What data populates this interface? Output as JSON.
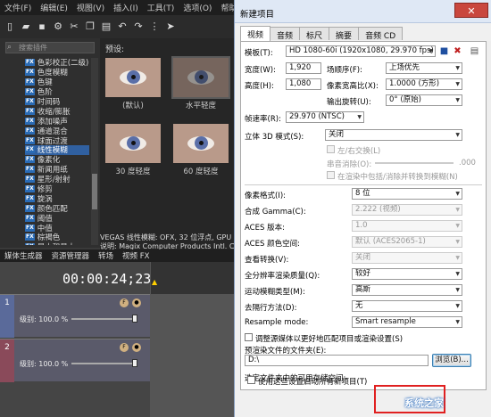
{
  "app": {
    "menu": [
      "文件(F)",
      "编辑(E)",
      "视图(V)",
      "插入(I)",
      "工具(T)",
      "选项(O)",
      "帮助"
    ],
    "fx_search_placeholder": "搜索插件",
    "fx_items": [
      {
        "label": "色彩校正(二级)",
        "selected": false
      },
      {
        "label": "色度模糊",
        "selected": false
      },
      {
        "label": "色键",
        "selected": false
      },
      {
        "label": "色阶",
        "selected": false
      },
      {
        "label": "时间码",
        "selected": false
      },
      {
        "label": "收缩/膨胀",
        "selected": false
      },
      {
        "label": "添加噪声",
        "selected": false
      },
      {
        "label": "通道混合",
        "selected": false
      },
      {
        "label": "球面过渡",
        "selected": false
      },
      {
        "label": "线性模糊",
        "selected": true
      },
      {
        "label": "像素化",
        "selected": false
      },
      {
        "label": "新闻用纸",
        "selected": false
      },
      {
        "label": "星形/射射",
        "selected": false
      },
      {
        "label": "修剪",
        "selected": false
      },
      {
        "label": "旋涡",
        "selected": false
      },
      {
        "label": "颜色匹配",
        "selected": false
      },
      {
        "label": "阈值",
        "selected": false
      },
      {
        "label": "中值",
        "selected": false
      },
      {
        "label": "棕褐色",
        "selected": false
      },
      {
        "label": "最小和最大",
        "selected": false
      }
    ],
    "fx_badge": "FX",
    "preview_label": "预设:",
    "thumbs": [
      {
        "caption": "(默认)"
      },
      {
        "caption": "水平轻度"
      },
      {
        "caption": "30 度轻度"
      },
      {
        "caption": "60 度轻度"
      }
    ],
    "status_line1": "VEGAS 线性模糊: OFX, 32 位浮点, GPU",
    "status_line2": "说明: Magix Computer Products Intl. Co.",
    "bottom_tabs": [
      "媒体生成器",
      "资源管理器",
      "转场",
      "视频 FX"
    ],
    "timecode": "00:00:24;23",
    "tracks": [
      {
        "num": "1",
        "level": "级别: 100.0 %",
        "color": "#5a6a9a"
      },
      {
        "num": "2",
        "level": "级别: 100.0 %",
        "color": "#8a4a5a"
      }
    ]
  },
  "dialog": {
    "title": "新建项目",
    "close_label": "✕",
    "tabs": [
      "视频",
      "音频",
      "标尺",
      "摘要",
      "音频 CD"
    ],
    "template_label": "模板(T):",
    "template_value": "HD 1080-60i (1920x1080, 29.970 fps)",
    "width_label": "宽度(W):",
    "width_value": "1,920",
    "field_order_label": "场顺序(F):",
    "field_order_value": "上场优先",
    "height_label": "高度(H):",
    "height_value": "1,080",
    "pixel_aspect_label": "像素宽高比(X):",
    "pixel_aspect_value": "1.0000 (方形)",
    "output_rotation_label": "输出旋转(U):",
    "output_rotation_value": "0° (原始)",
    "frame_rate_label": "帧速率(R):",
    "frame_rate_value": "29.970 (NTSC)",
    "stereo_label": "立体 3D 模式(S):",
    "stereo_value": "关闭",
    "swap_lr_label": "左/右交换(L)",
    "crosstalk_label": "串音消除(O):",
    "crosstalk_value": ".000",
    "include_render_label": "在渲染中包括/消除并转换到模糊(N)",
    "pixel_format_label": "像素格式(I):",
    "pixel_format_value": "8 位",
    "gamma_label": "合成 Gamma(C):",
    "gamma_value": "2.222 (视频)",
    "aces_version_label": "ACES 版本:",
    "aces_version_value": "1.0",
    "aces_space_label": "ACES 颜色空间:",
    "aces_space_value": "默认 (ACES2065-1)",
    "view_transform_label": "查看转换(V):",
    "view_transform_value": "关闭",
    "render_quality_label": "全分辨率渲染质量(Q):",
    "render_quality_value": "较好",
    "motion_blur_label": "运动模糊类型(M):",
    "motion_blur_value": "高斯",
    "deinterlace_label": "去隔行方法(D):",
    "deinterlace_value": "无",
    "resample_label": "Resample mode:",
    "resample_value": "Smart resample",
    "adjust_source_label": "调整源媒体以更好地匹配项目或渲染设置(S)",
    "prerender_label": "预渲染文件的文件夹(E):",
    "prerender_value": "D:\\",
    "browse_label": "浏览(B)...",
    "free_space_label": "选定文件夹中的可用存储空间:",
    "use_settings_label": "使用这些设置启动所有新项目(T)",
    "watermark": "系统之家"
  }
}
